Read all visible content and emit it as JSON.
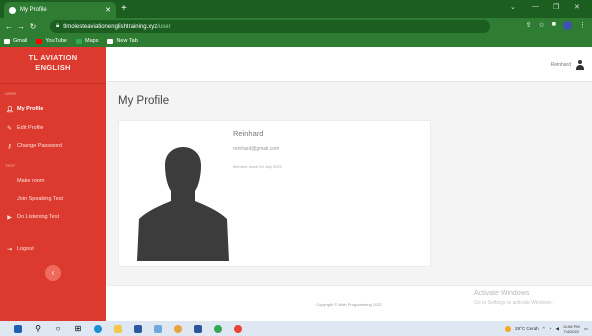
{
  "browser": {
    "tab_title": "My Profile",
    "tab_close": "✕",
    "new_tab": "+",
    "url_host": "tlmolesteaviationenglishtraining.xyz",
    "url_path": "/user",
    "bookmarks": [
      {
        "label": "Gmail",
        "icon": "gmail-icon",
        "color": "#ffffff"
      },
      {
        "label": "YouTube",
        "icon": "youtube-icon",
        "color": "#ff0000"
      },
      {
        "label": "Maps",
        "icon": "maps-icon",
        "color": "#34a853"
      },
      {
        "label": "New Tab",
        "icon": "newtab-icon",
        "color": "#ffffff"
      }
    ],
    "accent": "#2e7d32"
  },
  "sidebar": {
    "brand_line1": "TL AVIATION",
    "brand_line2": "ENGLISH",
    "section_user": "USER",
    "section_test": "TEST",
    "items": [
      {
        "label": "My Profile",
        "icon": "user-icon",
        "active": true
      },
      {
        "label": "Edit Profile",
        "icon": "user-edit-icon",
        "active": false
      },
      {
        "label": "Change Password",
        "icon": "key-icon",
        "active": false
      },
      {
        "label": "Make room",
        "icon": "",
        "active": false
      },
      {
        "label": "Join Speaking Test",
        "icon": "",
        "active": false
      },
      {
        "label": "Do Listening Test",
        "icon": "play-icon",
        "active": false
      },
      {
        "label": "Logout",
        "icon": "logout-icon",
        "active": false
      }
    ],
    "collapse_label": "‹",
    "color": "#dc3a2e"
  },
  "topbar": {
    "username": "Reinhard"
  },
  "main": {
    "title": "My Profile",
    "profile": {
      "name": "Reinhard",
      "email": "reinhard@gmail.com",
      "member_since": "Member since 04 July 2022"
    }
  },
  "footer": {
    "copyright": "Copyright © Web Programming 2022"
  },
  "watermark": {
    "line1": "Activate Windows",
    "line2": "Go to Settings to activate Windows."
  },
  "taskbar": {
    "weather": "29°C Cerah",
    "time": "11:56 PM",
    "date": "7/4/2022"
  }
}
